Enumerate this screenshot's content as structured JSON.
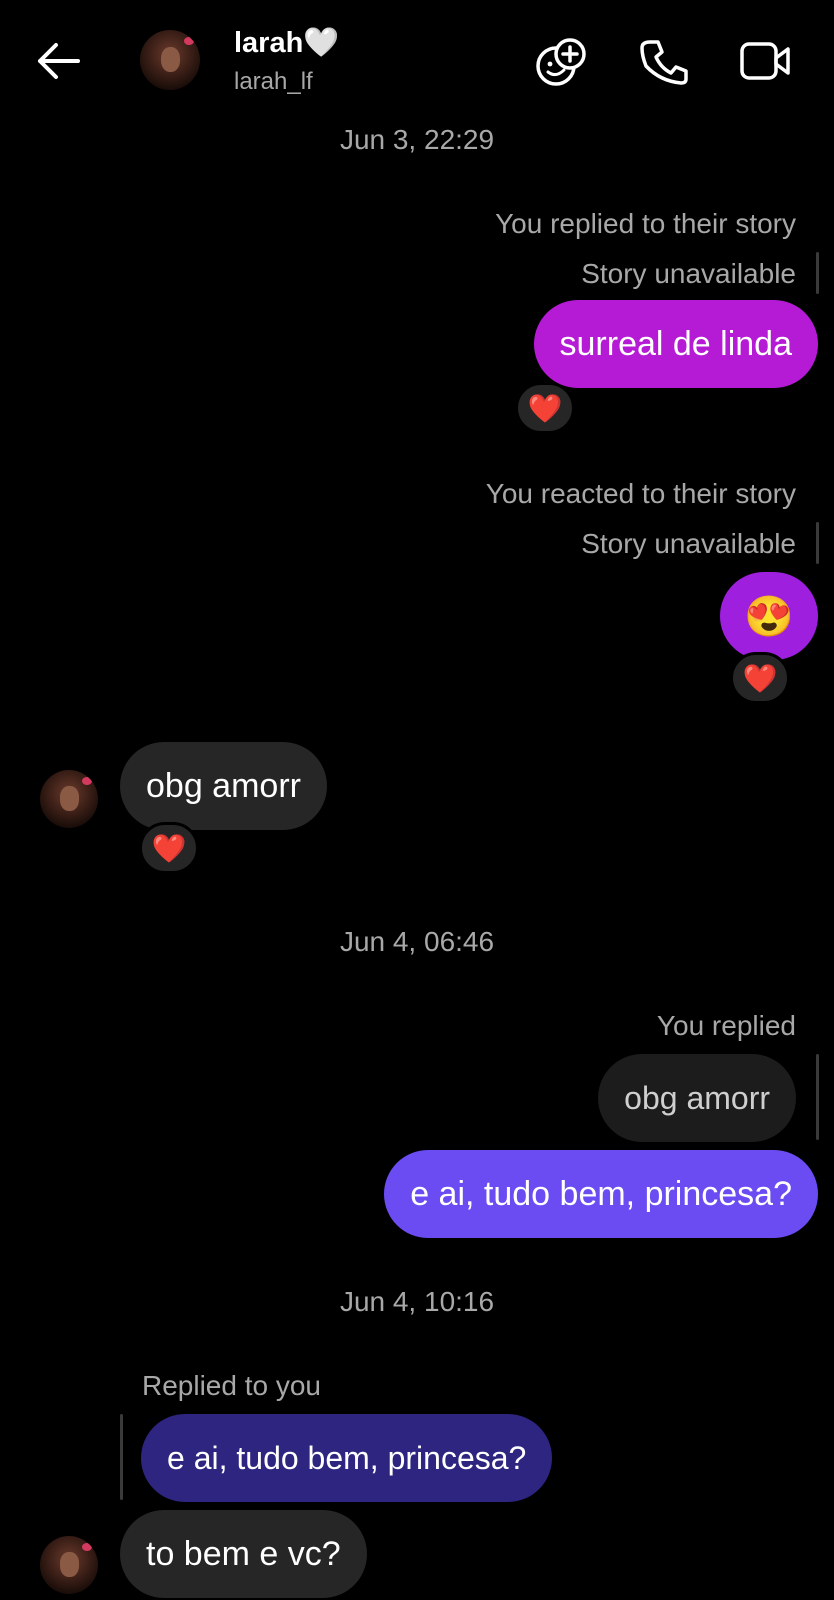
{
  "header": {
    "name": "larah",
    "name_suffix": "🤍",
    "username": "larah_lf"
  },
  "icons": {
    "back": "arrow-left-icon",
    "effects": "smiley-plus-icon",
    "call": "phone-icon",
    "video": "video-camera-icon",
    "heart_reaction": "red-heart-emoji",
    "heart_eyes": "heart-eyes-emoji"
  },
  "colors": {
    "sent_magenta": "#b51ad4",
    "sent_purple": "#9e1fde",
    "sent_violet": "#6a4cf2",
    "received": "#262626",
    "quoted_indigo": "#2e2580"
  },
  "thread": {
    "ts1": "Jun 3, 22:29",
    "msg1": {
      "note": "You replied to their story",
      "story": "Story unavailable",
      "text": "surreal de linda",
      "reaction": "❤️"
    },
    "msg2": {
      "note": "You reacted to their story",
      "story": "Story unavailable",
      "emoji": "😍",
      "reaction": "❤️"
    },
    "msg3": {
      "text": "obg amorr",
      "reaction": "❤️"
    },
    "ts2": "Jun 4, 06:46",
    "msg4": {
      "note": "You replied",
      "quoted": "obg amorr",
      "text": "e ai, tudo bem, princesa?"
    },
    "ts3": "Jun 4, 10:16",
    "msg5": {
      "note": "Replied to you",
      "quoted": "e ai, tudo bem, princesa?",
      "text": "to bem e vc?"
    }
  }
}
